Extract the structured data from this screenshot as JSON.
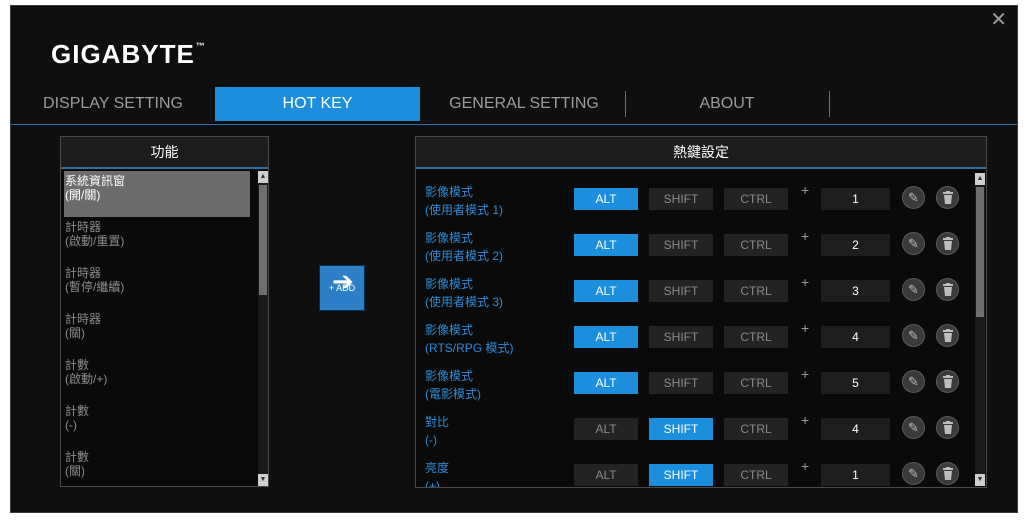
{
  "app": {
    "brand": "GIGABYTE",
    "tm": "™",
    "close": "✕"
  },
  "tabs": [
    {
      "label": "DISPLAY SETTING"
    },
    {
      "label": "HOT KEY"
    },
    {
      "label": "GENERAL SETTING"
    },
    {
      "label": "ABOUT"
    }
  ],
  "function_panel": {
    "title": "功能",
    "items": [
      {
        "line1": "系統資訊窗",
        "line2": "(開/關)"
      },
      {
        "line1": "計時器",
        "line2": "(啟動/重置)"
      },
      {
        "line1": "計時器",
        "line2": "(暫停/繼續)"
      },
      {
        "line1": "計時器",
        "line2": "(關)"
      },
      {
        "line1": "計數",
        "line2": "(啟動/+)"
      },
      {
        "line1": "計數",
        "line2": "(-)"
      },
      {
        "line1": "計數",
        "line2": "(關)"
      }
    ]
  },
  "add_button": {
    "label": "+ ADD",
    "icon": "arrow-right-icon"
  },
  "hotkey_panel": {
    "title": "熱鍵設定",
    "key_labels": {
      "alt": "ALT",
      "shift": "SHIFT",
      "ctrl": "CTRL",
      "plus": "+"
    },
    "rows": [
      {
        "line1": "影像模式",
        "line2": "(使用者模式 1)",
        "alt": true,
        "shift": false,
        "ctrl": false,
        "key": "1"
      },
      {
        "line1": "影像模式",
        "line2": "(使用者模式 2)",
        "alt": true,
        "shift": false,
        "ctrl": false,
        "key": "2"
      },
      {
        "line1": "影像模式",
        "line2": "(使用者模式 3)",
        "alt": true,
        "shift": false,
        "ctrl": false,
        "key": "3"
      },
      {
        "line1": "影像模式",
        "line2": "(RTS/RPG 模式)",
        "alt": true,
        "shift": false,
        "ctrl": false,
        "key": "4"
      },
      {
        "line1": "影像模式",
        "line2": "(電影模式)",
        "alt": true,
        "shift": false,
        "ctrl": false,
        "key": "5"
      },
      {
        "line1": "對比",
        "line2": "(-)",
        "alt": false,
        "shift": true,
        "ctrl": false,
        "key": "4"
      },
      {
        "line1": "亮度",
        "line2": "(+)",
        "alt": false,
        "shift": true,
        "ctrl": false,
        "key": "1"
      }
    ]
  },
  "colors": {
    "accent": "#1b8edd",
    "label_blue": "#2d8ad6",
    "background": "#0f0f0f"
  }
}
